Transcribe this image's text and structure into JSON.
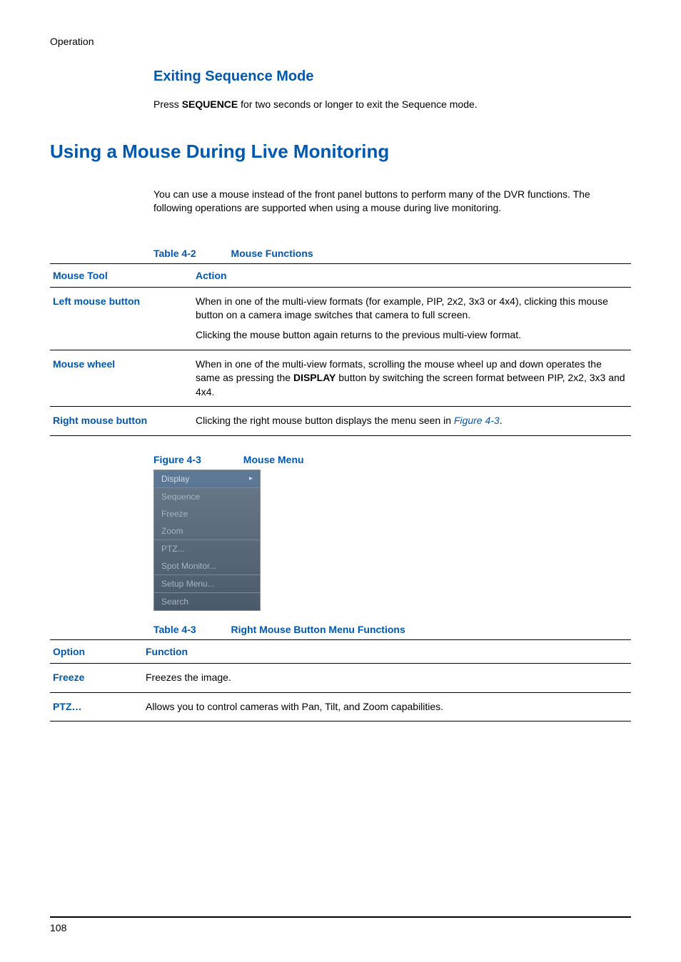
{
  "header": {
    "section_label": "Operation"
  },
  "exiting": {
    "heading": "Exiting Sequence Mode",
    "text_prefix": "Press ",
    "text_bold": "SEQUENCE",
    "text_suffix": " for two seconds or longer to exit the Sequence mode."
  },
  "using_mouse": {
    "heading": "Using a Mouse During Live Monitoring",
    "intro": "You can use a mouse instead of the front panel buttons to perform many of the DVR functions. The following operations are supported when using a mouse during live monitoring."
  },
  "table42": {
    "label": "Table 4-2",
    "title": "Mouse Functions",
    "col1": "Mouse Tool",
    "col2": "Action",
    "rows": {
      "left": {
        "tool": "Left mouse button",
        "p1": "When in one of the multi-view formats (for example, PIP, 2x2, 3x3 or 4x4), clicking this mouse button on a camera image switches that camera to full screen.",
        "p2": "Clicking the mouse button again returns to the previous multi-view format."
      },
      "wheel": {
        "tool": "Mouse wheel",
        "p1_prefix": "When in one of the multi-view formats, scrolling the mouse wheel up and down operates the same as pressing the ",
        "p1_bold": "DISPLAY",
        "p1_suffix": " button by switching the screen format between PIP, 2x2, 3x3 and 4x4."
      },
      "right": {
        "tool": "Right mouse button",
        "p1_prefix": "Clicking the right mouse button displays the menu seen in ",
        "p1_link": "Figure 4-3",
        "p1_suffix": "."
      }
    }
  },
  "figure43": {
    "label": "Figure 4-3",
    "title": "Mouse Menu",
    "items": {
      "display": "Display",
      "sequence": "Sequence",
      "freeze": "Freeze",
      "zoom": "Zoom",
      "ptz": "PTZ...",
      "spot": "Spot Monitor...",
      "setup": "Setup Menu...",
      "search": "Search"
    }
  },
  "table43": {
    "label": "Table 4-3",
    "title": "Right Mouse Button Menu Functions",
    "col1": "Option",
    "col2": "Function",
    "rows": {
      "freeze": {
        "option": "Freeze",
        "function": "Freezes the image."
      },
      "ptz": {
        "option": "PTZ…",
        "function": "Allows you to control cameras with Pan, Tilt, and Zoom capabilities."
      }
    }
  },
  "footer": {
    "page": "108"
  }
}
